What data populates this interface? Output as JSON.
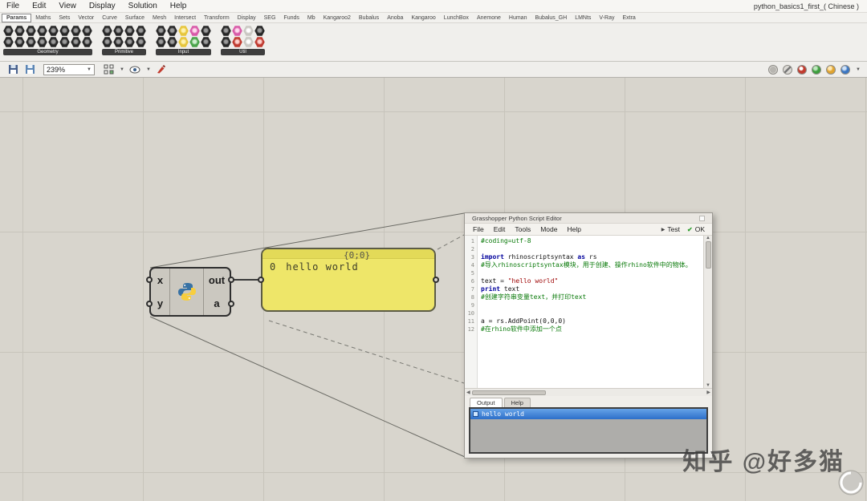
{
  "window": {
    "doc_title": "python_basics1_first_( Chinese )"
  },
  "menubar": {
    "items": [
      "File",
      "Edit",
      "View",
      "Display",
      "Solution",
      "Help"
    ]
  },
  "ribbon": {
    "tabs": [
      "Params",
      "Maths",
      "Sets",
      "Vector",
      "Curve",
      "Surface",
      "Mesh",
      "Intersect",
      "Transform",
      "Display",
      "SEG",
      "Funds",
      "Mb",
      "Kangaroo2",
      "Bubalus",
      "Anoba",
      "Kangaroo",
      "LunchBox",
      "Anemone",
      "Human",
      "Bubalus_GH",
      "LMNts",
      "V-Ray",
      "Extra"
    ]
  },
  "toolbar": {
    "groups": [
      {
        "label": "Geometry",
        "rows": [
          [
            "dark",
            "dark",
            "dark",
            "dark",
            "dark",
            "dark",
            "dark",
            "dark"
          ],
          [
            "dark",
            "dark",
            "dark",
            "dark",
            "dark",
            "dark",
            "dark",
            "dark"
          ]
        ]
      },
      {
        "label": "Primitive",
        "rows": [
          [
            "dark",
            "dark",
            "dark",
            "dark"
          ],
          [
            "dark",
            "dark",
            "dark",
            "dark"
          ]
        ]
      },
      {
        "label": "Input",
        "rows": [
          [
            "dark",
            "dark",
            "yellow",
            "pink",
            "dark"
          ],
          [
            "dark",
            "dark",
            "yellow",
            "green",
            "dark"
          ]
        ]
      },
      {
        "label": "Util",
        "rows": [
          [
            "dark",
            "pink",
            "light",
            "dark"
          ],
          [
            "dark",
            "red",
            "light",
            "red"
          ]
        ]
      }
    ]
  },
  "canvas_toolbar": {
    "zoom": "239%"
  },
  "component": {
    "type": "GhPython Script",
    "inputs": [
      "x",
      "y"
    ],
    "outputs": [
      "out",
      "a"
    ]
  },
  "panel": {
    "index": "0",
    "text": "hello world",
    "path": "{0;0}"
  },
  "editor": {
    "title": "Grasshopper Python Script Editor",
    "menu": [
      "File",
      "Edit",
      "Tools",
      "Mode",
      "Help"
    ],
    "test_label": "Test",
    "ok_label": "OK",
    "tabs": [
      "Output",
      "Help"
    ],
    "output_text": "hello world",
    "code_lines": [
      {
        "n": 1,
        "parts": [
          {
            "t": "#coding=utf-8",
            "c": "comment"
          }
        ]
      },
      {
        "n": 2,
        "parts": []
      },
      {
        "n": 3,
        "parts": [
          {
            "t": "import",
            "c": "keyword"
          },
          {
            "t": " rhinoscriptsyntax ",
            "c": "plain"
          },
          {
            "t": "as",
            "c": "keyword"
          },
          {
            "t": " rs",
            "c": "plain"
          }
        ]
      },
      {
        "n": 4,
        "parts": [
          {
            "t": "#导入rhinoscriptsyntax模块，用于创建、操作rhino软件中的物体。",
            "c": "comment"
          }
        ]
      },
      {
        "n": 5,
        "parts": []
      },
      {
        "n": 6,
        "parts": [
          {
            "t": "text = ",
            "c": "plain"
          },
          {
            "t": "\"hello world\"",
            "c": "string"
          }
        ]
      },
      {
        "n": 7,
        "parts": [
          {
            "t": "print",
            "c": "keyword"
          },
          {
            "t": " text",
            "c": "plain"
          }
        ]
      },
      {
        "n": 8,
        "parts": [
          {
            "t": "#创建字符串变量text，并打印text",
            "c": "comment"
          }
        ]
      },
      {
        "n": 9,
        "parts": []
      },
      {
        "n": 10,
        "parts": []
      },
      {
        "n": 11,
        "parts": [
          {
            "t": "a = rs.AddPoint(0,0,0)",
            "c": "plain"
          }
        ]
      },
      {
        "n": 12,
        "parts": [
          {
            "t": "#在rhino软件中添加一个点",
            "c": "comment"
          }
        ]
      }
    ]
  },
  "watermark": {
    "text": "知乎 @好多猫"
  },
  "colors": {
    "canvas_bg": "#d8d5cd",
    "panel_yellow": "#eee669",
    "selection_blue": "#2d6fc9",
    "comment_green": "#0a7a0a",
    "keyword_blue": "#00009c",
    "string_red": "#9c0000"
  }
}
